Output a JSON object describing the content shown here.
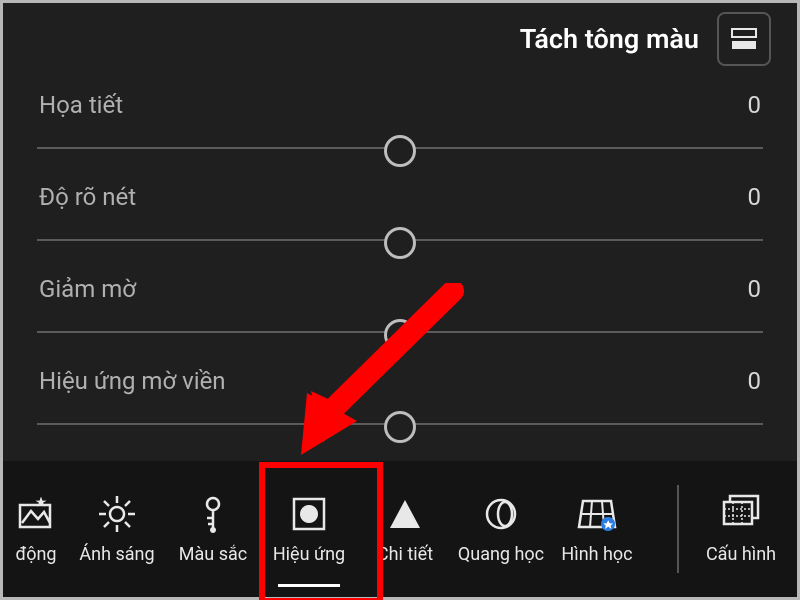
{
  "header": {
    "title": "Tách tông màu"
  },
  "sliders": [
    {
      "label": "Họa tiết",
      "value": "0",
      "pos": 50
    },
    {
      "label": "Độ rõ nét",
      "value": "0",
      "pos": 50
    },
    {
      "label": "Giảm mờ",
      "value": "0",
      "pos": 50
    },
    {
      "label": "Hiệu ứng mờ viền",
      "value": "0",
      "pos": 50
    }
  ],
  "toolbar": {
    "items": [
      {
        "id": "auto",
        "label": "động"
      },
      {
        "id": "light",
        "label": "Ánh sáng"
      },
      {
        "id": "color",
        "label": "Màu sắc"
      },
      {
        "id": "effects",
        "label": "Hiệu ứng"
      },
      {
        "id": "detail",
        "label": "Chi tiết"
      },
      {
        "id": "optics",
        "label": "Quang học"
      },
      {
        "id": "geometry",
        "label": "Hình học"
      }
    ],
    "right": {
      "id": "profiles",
      "label": "Cấu hình"
    },
    "active": "effects"
  }
}
